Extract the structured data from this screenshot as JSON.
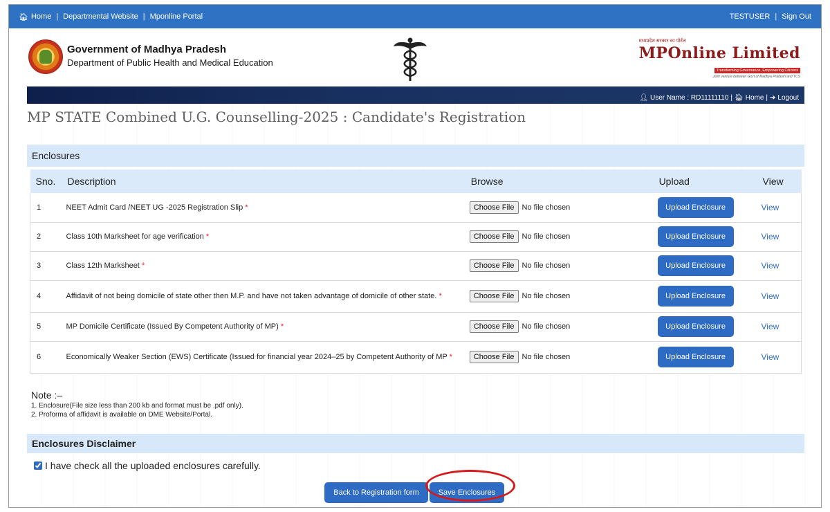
{
  "topbar": {
    "links": [
      "Home",
      "Departmental Website",
      "Mponline Portal"
    ],
    "user": "TESTUSER",
    "signout": "Sign Out"
  },
  "header": {
    "gov_title": "Government of Madhya Pradesh",
    "gov_sub": "Department of Public Health and Medical Education",
    "brand_tiny": "मध्यप्रदेश सरकार का पोर्टल",
    "brand": "MPOnline Limited",
    "brand_tagline": "Transforming Governance, Empowering Citizens",
    "brand_tagline2": "Joint venture between Govt of Madhya Pradesh and TCS"
  },
  "bluebar": {
    "user_label": "User Name : RD11111110",
    "home": "Home",
    "logout": "Logout"
  },
  "page_title": "MP STATE Combined U.G. Counselling-2025 : Candidate's Registration",
  "enclosures": {
    "heading": "Enclosures",
    "columns": [
      "Sno.",
      "Description",
      "Browse",
      "Upload",
      "View"
    ],
    "choose_file": "Choose File",
    "no_file": "No file chosen",
    "upload_label": "Upload Enclosure",
    "view_label": "View",
    "rows": [
      {
        "sno": "1",
        "desc": "NEET Admit Card /NEET UG -2025 Registration Slip",
        "req": "*"
      },
      {
        "sno": "2",
        "desc": "Class 10th Marksheet for age verification",
        "req": "*"
      },
      {
        "sno": "3",
        "desc": "Class 12th Marksheet",
        "req": "*"
      },
      {
        "sno": "4",
        "desc": "Affidavit of not being domicile of state other then M.P. and have not taken advantage of domicile of other state.",
        "req": "*"
      },
      {
        "sno": "5",
        "desc": "MP Domicile Certificate (Issued By Competent Authority of MP)",
        "req": "*"
      },
      {
        "sno": "6",
        "desc": "Economically Weaker Section (EWS) Certificate (Issued for financial year 2024–25 by Competent Authority of MP",
        "req": "*"
      }
    ]
  },
  "note": {
    "title": "Note :–",
    "line1": "1. Enclosure(File size less than 200 kb and format must be .pdf only).",
    "line2": "2. Proforma of affidavit is available on DME Website/Portal."
  },
  "disclaimer": {
    "heading": "Enclosures Disclaimer",
    "check_label": "I have check all the uploaded enclosures carefully.",
    "checked": true
  },
  "actions": {
    "back": "Back to Registration form",
    "save": "Save Enclosures"
  },
  "colors": {
    "topbar": "#2f72c4",
    "button": "#2e6bc4",
    "section_bg": "#d7e8fa",
    "highlight_circle": "#d61a1a"
  }
}
